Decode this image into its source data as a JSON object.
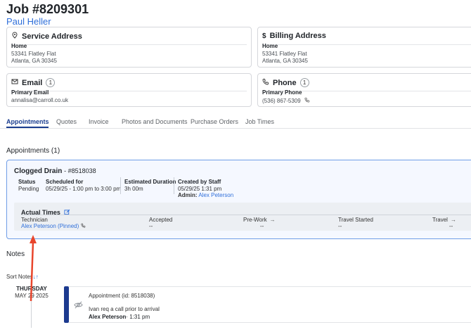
{
  "header": {
    "job_title": "Job #8209301",
    "customer_name": "Paul Heller"
  },
  "cards": {
    "service_address": {
      "title": "Service Address",
      "subtitle": "Home",
      "line1": "53341 Flatley Flat",
      "line2": "Atlanta, GA 30345"
    },
    "billing_address": {
      "title": "Billing Address",
      "subtitle": "Home",
      "line1": "53341 Flatley Flat",
      "line2": "Atlanta, GA 30345"
    },
    "email": {
      "title": "Email",
      "count": "1",
      "subtitle": "Primary Email",
      "value": "annalisa@carroll.co.uk"
    },
    "phone": {
      "title": "Phone",
      "count": "1",
      "subtitle": "Primary Phone",
      "value": "(536) 867-5309"
    }
  },
  "tabs": [
    {
      "label": "Appointments",
      "active": true
    },
    {
      "label": "Quotes",
      "active": false
    },
    {
      "label": "Invoice",
      "active": false
    },
    {
      "label": "Photos and Documents",
      "active": false
    },
    {
      "label": "Purchase Orders",
      "active": false
    },
    {
      "label": "Job Times",
      "active": false
    }
  ],
  "appointments": {
    "section_title": "Appointments (1)",
    "appointment": {
      "name": "Clogged Drain",
      "number": "- #8518038",
      "status_label": "Status",
      "status_value": "Pending",
      "scheduled_label": "Scheduled for",
      "scheduled_value": "05/29/25 - 1:00 pm to 3:00 pm",
      "duration_label": "Estimated Duration",
      "duration_value": "3h 00m",
      "created_label": "Created by Staff",
      "created_value": "05/29/25 1:31 pm",
      "admin_label": "Admin:",
      "admin_value": "Alex Peterson"
    },
    "actual_times": {
      "title": "Actual Times",
      "technician_label": "Technician",
      "technician_value": "Alex Peterson (Pinned)",
      "accepted_label": "Accepted",
      "accepted_value": "--",
      "prework_label": "Pre-Work",
      "prework_value": "--",
      "travel_started_label": "Travel Started",
      "travel_started_value": "--",
      "travel_label": "Travel",
      "travel_value": "--"
    }
  },
  "notes": {
    "section_title": "Notes",
    "sort_label": "Sort Notes",
    "sort_icon": "↓↑",
    "entry": {
      "day": "THURSDAY",
      "date": "MAY 29 2025",
      "heading": "Appointment (id: 8518038)",
      "text": "Ivan req a call prior to arrival",
      "author": "Alex Peterson",
      "time": "· 1:31 pm"
    }
  },
  "colors": {
    "accent": "#1a3d8f",
    "link": "#2f6fda",
    "annotation_arrow": "#e8452c",
    "appointment_border": "#6f9de6"
  },
  "icons": {
    "service_address": "location-pin-icon",
    "billing_address": "dollar-icon",
    "email": "envelope-icon",
    "phone": "phone-icon",
    "edit": "edit-icon",
    "note_visibility": "eye-off-icon"
  }
}
